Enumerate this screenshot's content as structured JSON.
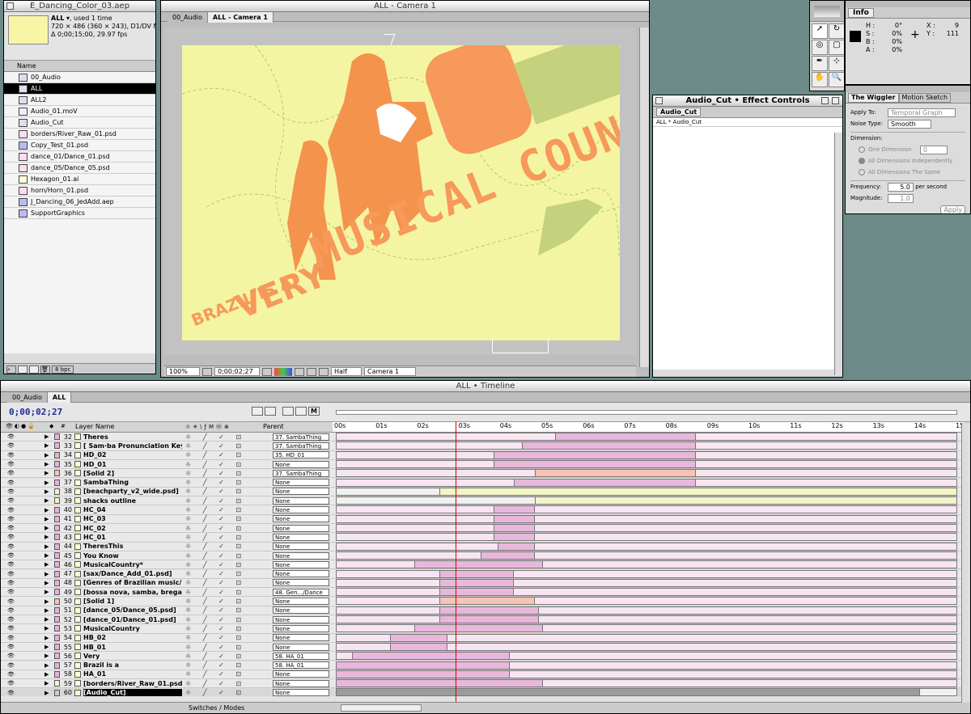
{
  "project": {
    "title": "E_Dancing_Color_03.aep",
    "comp_name": "ALL",
    "used": ", used 1 time",
    "dims": "720 × 486  (360 × 243), D1/DV NTSC",
    "dur": "Δ 0;00;15;00, 29.97 fps",
    "col_name": "Name",
    "bpc": "8 bpc",
    "items": [
      {
        "name": "00_Audio",
        "type": "comp"
      },
      {
        "name": "ALL",
        "type": "comp",
        "selected": true
      },
      {
        "name": "ALL2",
        "type": "comp"
      },
      {
        "name": "Audio_01.moV",
        "type": "movie"
      },
      {
        "name": "Audio_Cut",
        "type": "comp"
      },
      {
        "name": "borders/River_Raw_01.psd",
        "type": "psd"
      },
      {
        "name": "Copy_Test_01.psd",
        "type": "folder"
      },
      {
        "name": "dance_01/Dance_01.psd",
        "type": "psd"
      },
      {
        "name": "dance_05/Dance_05.psd",
        "type": "psd"
      },
      {
        "name": "Hexagon_01.ai",
        "type": "ai"
      },
      {
        "name": "horn/Horn_01.psd",
        "type": "psd"
      },
      {
        "name": "J_Dancing_06_JedAdd.aep",
        "type": "folder"
      },
      {
        "name": "SupportGraphics",
        "type": "folder"
      }
    ]
  },
  "comp_window": {
    "title": "ALL - Camera 1",
    "tabs": [
      "00_Audio",
      "ALL - Camera 1"
    ],
    "canvas_text_1": "BRAZIL IS A",
    "canvas_text_2": "VERY",
    "canvas_text_3": "MUSICAL COUNTRY",
    "zoom": "100%",
    "timecode": "0;00;02;27",
    "resolution": "Half",
    "camera": "Camera 1"
  },
  "effect_controls": {
    "title": "Audio_Cut • Effect Controls",
    "tab": "Audio_Cut",
    "path": "ALL * Audio_Cut"
  },
  "info": {
    "tab": "Info",
    "h": "0°",
    "s": "0%",
    "b": "0%",
    "a": "0%",
    "x": "9",
    "y": "111"
  },
  "wiggler": {
    "tabs": [
      "The Wiggler",
      "Motion Sketch"
    ],
    "apply_to_label": "Apply To:",
    "apply_to": "Temporal Graph",
    "noise_label": "Noise Type:",
    "noise": "Smooth",
    "dimension_label": "Dimension:",
    "one_dim": "One Dimension",
    "one_dim_val": "0",
    "all_indep": "All Dimensions Independently",
    "all_same": "All Dimensions The Same",
    "freq_label": "Frequency:",
    "freq": "5.0",
    "freq_unit": "per second",
    "mag_label": "Magnitude:",
    "mag": "1.0",
    "apply": "Apply"
  },
  "timeline": {
    "title": "ALL • Timeline",
    "tabs": [
      "00_Audio",
      "ALL"
    ],
    "timecode": "0;00;02;27",
    "col_layer": "Layer Name",
    "col_parent": "Parent",
    "footer": "Switches / Modes",
    "ticks": [
      "00s",
      "01s",
      "02s",
      "03s",
      "04s",
      "05s",
      "06s",
      "07s",
      "08s",
      "09s",
      "10s",
      "11s",
      "12s",
      "13s",
      "14s",
      "15s"
    ],
    "playhead": 2.9,
    "layers": [
      {
        "n": "32",
        "name": "Theres",
        "parent": "37. SambaThing",
        "label": "#e7b1d6",
        "bars": [
          {
            "s": 5.3,
            "e": 8.7,
            "c": "pink"
          }
        ],
        "in": 5.3,
        "out": 8.7
      },
      {
        "n": "33",
        "name": "[ Sam·ba Pronunciation Key  (]",
        "parent": "37. SambaThing",
        "label": "#e7b1d6",
        "bars": [
          {
            "s": 4.5,
            "e": 8.7,
            "c": "pink"
          }
        ]
      },
      {
        "n": "34",
        "name": "HD_02",
        "parent": "35. HD_01",
        "label": "#e7b1d6",
        "bars": [
          {
            "s": 3.8,
            "e": 8.7,
            "c": "pink"
          }
        ]
      },
      {
        "n": "35",
        "name": "HD_01",
        "parent": "None",
        "label": "#e7b1d6",
        "bars": [
          {
            "s": 3.8,
            "e": 8.7,
            "c": "pink"
          }
        ]
      },
      {
        "n": "36",
        "name": "[Solid 2]",
        "parent": "37. SambaThing",
        "label": "#f6c3b5",
        "bars": [
          {
            "s": 4.8,
            "e": 8.7,
            "c": "salmon"
          }
        ]
      },
      {
        "n": "37",
        "name": "SambaThing",
        "parent": "None",
        "label": "#e7b1d6",
        "bars": [
          {
            "s": 4.3,
            "e": 8.7,
            "c": "pink"
          }
        ]
      },
      {
        "n": "38",
        "name": "[beachparty_v2_wide.psd]",
        "parent": "None",
        "label": "#f4f5c6",
        "bars": [
          {
            "s": 2.5,
            "e": 15,
            "c": "yellow"
          }
        ]
      },
      {
        "n": "39",
        "name": "shacks outline",
        "parent": "None",
        "label": "#f4f5c6",
        "bars": [
          {
            "s": 4.8,
            "e": 15,
            "c": "yellow"
          }
        ]
      },
      {
        "n": "40",
        "name": "HC_04",
        "parent": "None",
        "label": "#e7b1d6",
        "bars": [
          {
            "s": 3.8,
            "e": 4.8,
            "c": "pink"
          }
        ]
      },
      {
        "n": "41",
        "name": "HC_03",
        "parent": "None",
        "label": "#e7b1d6",
        "bars": [
          {
            "s": 3.8,
            "e": 4.8,
            "c": "pink"
          }
        ]
      },
      {
        "n": "42",
        "name": "HC_02",
        "parent": "None",
        "label": "#e7b1d6",
        "bars": [
          {
            "s": 3.8,
            "e": 4.8,
            "c": "pink"
          }
        ]
      },
      {
        "n": "43",
        "name": "HC_01",
        "parent": "None",
        "label": "#e7b1d6",
        "bars": [
          {
            "s": 3.8,
            "e": 4.8,
            "c": "pink"
          }
        ]
      },
      {
        "n": "44",
        "name": "TheresThis",
        "parent": "None",
        "label": "#e7b1d6",
        "bars": [
          {
            "s": 3.9,
            "e": 4.8,
            "c": "pink"
          }
        ]
      },
      {
        "n": "45",
        "name": "You Know",
        "parent": "None",
        "label": "#e7b1d6",
        "bars": [
          {
            "s": 3.5,
            "e": 4.8,
            "c": "pink"
          }
        ]
      },
      {
        "n": "46",
        "name": "MusicalCountry*",
        "parent": "None",
        "label": "#e7b1d6",
        "bars": [
          {
            "s": 1.9,
            "e": 5.0,
            "c": "pink"
          }
        ]
      },
      {
        "n": "47",
        "name": "[sax/Dance_Add_01.psd]",
        "parent": "None",
        "label": "#e7b1d6",
        "bars": [
          {
            "s": 2.5,
            "e": 4.3,
            "c": "pink"
          }
        ]
      },
      {
        "n": "48",
        "name": "[Genres of Brazilian music/Dan]",
        "parent": "None",
        "label": "#e7b1d6",
        "bars": [
          {
            "s": 2.5,
            "e": 4.3,
            "c": "pink"
          }
        ]
      },
      {
        "n": "49",
        "name": "[bossa nova, samba, brega, b...",
        "parent": "48. Gen.../Dance",
        "label": "#e7b1d6",
        "bars": [
          {
            "s": 2.5,
            "e": 4.3,
            "c": "pink"
          }
        ]
      },
      {
        "n": "50",
        "name": "[Solid 1]",
        "parent": "None",
        "label": "#f6c3b5",
        "bars": [
          {
            "s": 2.5,
            "e": 4.8,
            "c": "salmon"
          }
        ]
      },
      {
        "n": "51",
        "name": "[dance_05/Dance_05.psd]",
        "parent": "None",
        "label": "#e7b1d6",
        "bars": [
          {
            "s": 2.5,
            "e": 4.9,
            "c": "pink"
          }
        ]
      },
      {
        "n": "52",
        "name": "[dance_01/Dance_01.psd]",
        "parent": "None",
        "label": "#e7b1d6",
        "bars": [
          {
            "s": 2.5,
            "e": 4.9,
            "c": "pink"
          }
        ]
      },
      {
        "n": "53",
        "name": "MusicalCountry",
        "parent": "None",
        "label": "#e7b1d6",
        "bars": [
          {
            "s": 1.9,
            "e": 5.0,
            "c": "pink"
          }
        ]
      },
      {
        "n": "54",
        "name": "HB_02",
        "parent": "None",
        "label": "#e7b1d6",
        "bars": [
          {
            "s": 1.3,
            "e": 2.7,
            "c": "pink"
          }
        ]
      },
      {
        "n": "55",
        "name": "HB_01",
        "parent": "None",
        "label": "#e7b1d6",
        "bars": [
          {
            "s": 1.3,
            "e": 2.7,
            "c": "pink"
          }
        ]
      },
      {
        "n": "56",
        "name": "Very",
        "parent": "58. HA_01",
        "label": "#e7b1d6",
        "bars": [
          {
            "s": 0.4,
            "e": 4.2,
            "c": "pink"
          }
        ]
      },
      {
        "n": "57",
        "name": "Brazil is a",
        "parent": "58. HA_01",
        "label": "#e7b1d6",
        "bars": [
          {
            "s": 0.0,
            "e": 4.2,
            "c": "pink"
          }
        ]
      },
      {
        "n": "58",
        "name": "HA_01",
        "parent": "None",
        "label": "#e7b1d6",
        "bars": [
          {
            "s": 0.0,
            "e": 4.2,
            "c": "pink"
          }
        ]
      },
      {
        "n": "59",
        "name": "[borders/River_Raw_01.psd]",
        "parent": "None",
        "label": "#f4f5c6",
        "bars": [
          {
            "s": 0.0,
            "e": 5.0,
            "c": "pink"
          }
        ]
      },
      {
        "n": "60",
        "name": "[Audio_Cut]",
        "parent": "None",
        "label": "#cccccc",
        "bars": [
          {
            "s": 0.0,
            "e": 14.1,
            "c": "gray"
          }
        ],
        "selected": true
      }
    ]
  }
}
